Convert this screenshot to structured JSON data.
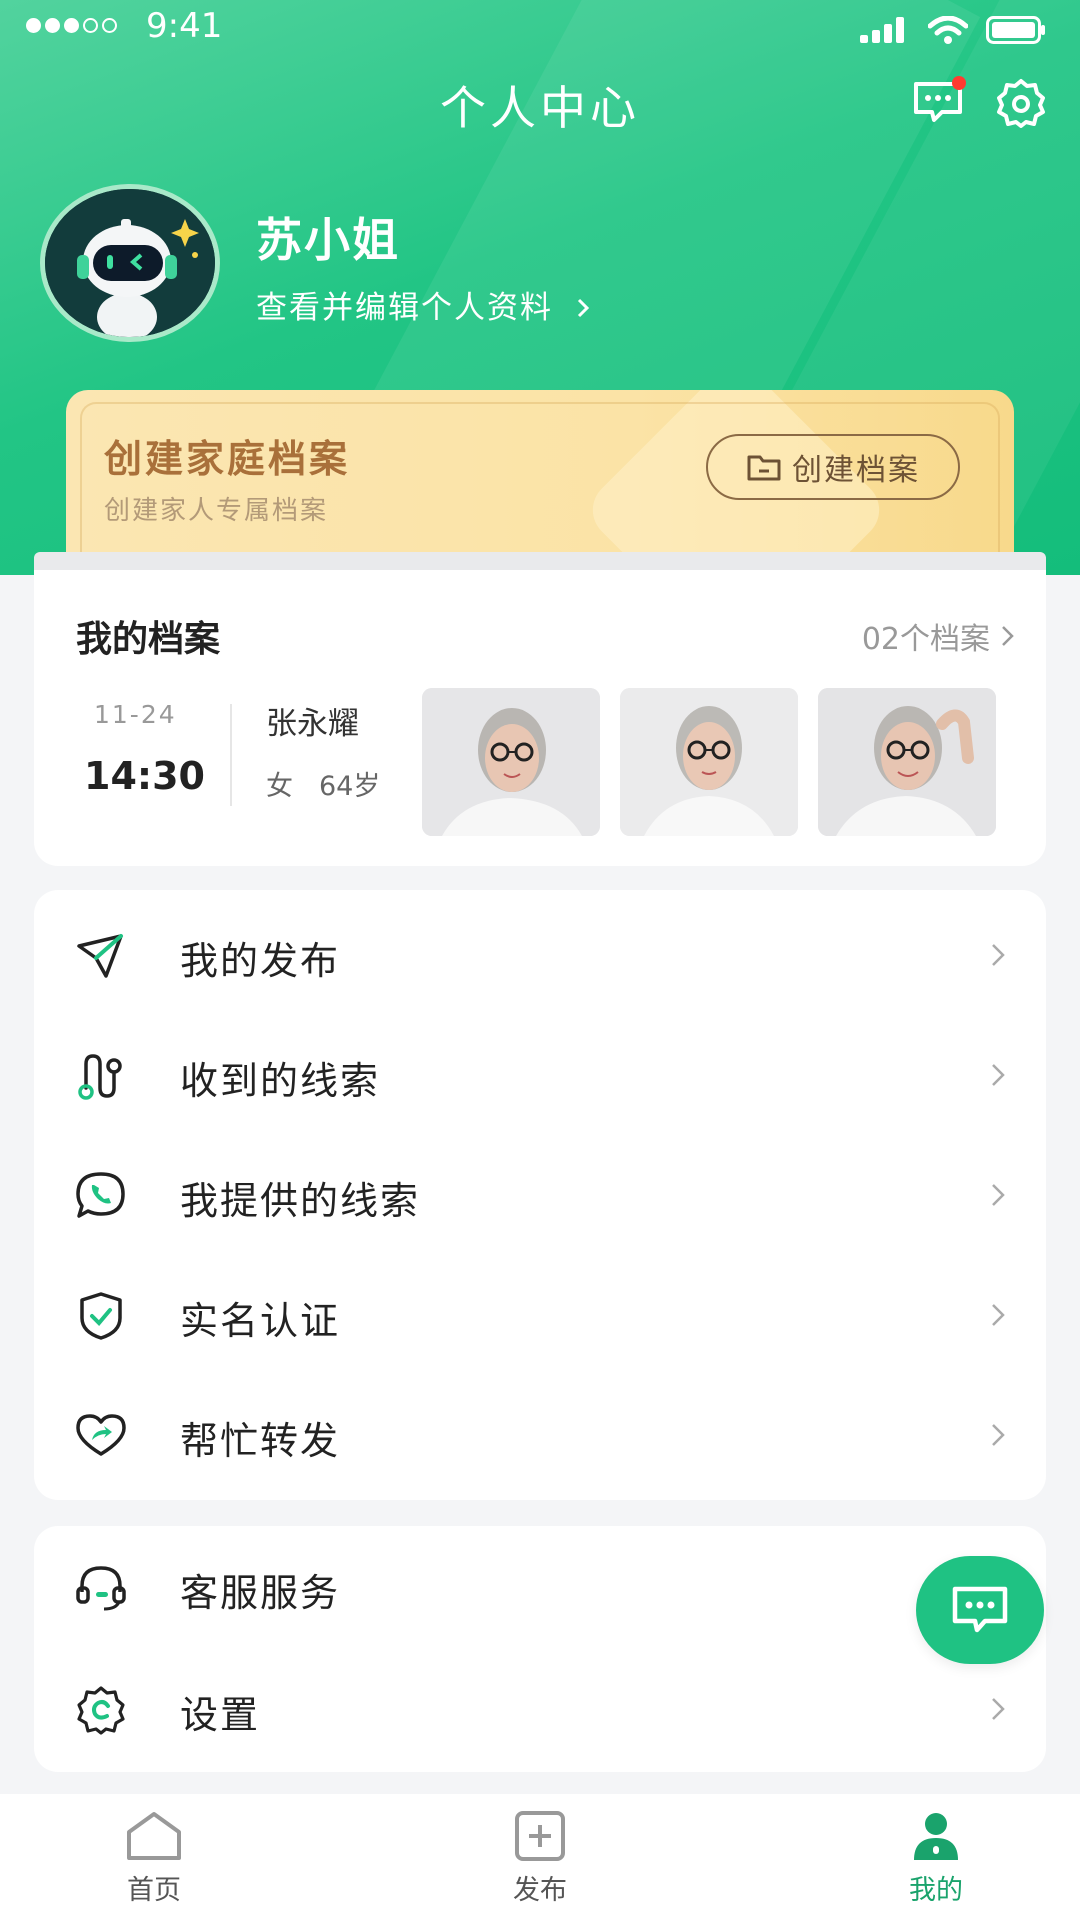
{
  "status_bar": {
    "time": "9:41"
  },
  "header": {
    "title": "个人中心",
    "user_name": "苏小姐",
    "edit_profile": "查看并编辑个人资料"
  },
  "family_banner": {
    "title": "创建家庭档案",
    "subtitle": "创建家人专属档案",
    "button": "创建档案"
  },
  "archives": {
    "title": "我的档案",
    "count": "02个档案",
    "latest": {
      "date": "11-24",
      "time": "14:30",
      "name": "张永耀",
      "gender": "女",
      "age": "64岁"
    }
  },
  "menu_main": [
    {
      "label": "我的发布",
      "icon": "paper-plane-icon"
    },
    {
      "label": "收到的线索",
      "icon": "route-icon"
    },
    {
      "label": "我提供的线索",
      "icon": "chat-phone-icon"
    },
    {
      "label": "实名认证",
      "icon": "shield-check-icon"
    },
    {
      "label": "帮忙转发",
      "icon": "heart-share-icon"
    }
  ],
  "menu_secondary": [
    {
      "label": "客服服务",
      "icon": "headset-icon"
    },
    {
      "label": "设置",
      "icon": "gear-icon"
    }
  ],
  "tabbar": [
    {
      "label": "首页",
      "icon": "home-icon"
    },
    {
      "label": "发布",
      "icon": "plus-square-icon"
    },
    {
      "label": "我的",
      "icon": "person-icon"
    }
  ],
  "colors": {
    "primary": "#1fc283",
    "active_tab": "#1aa36c",
    "banner_text": "#a9703a"
  }
}
